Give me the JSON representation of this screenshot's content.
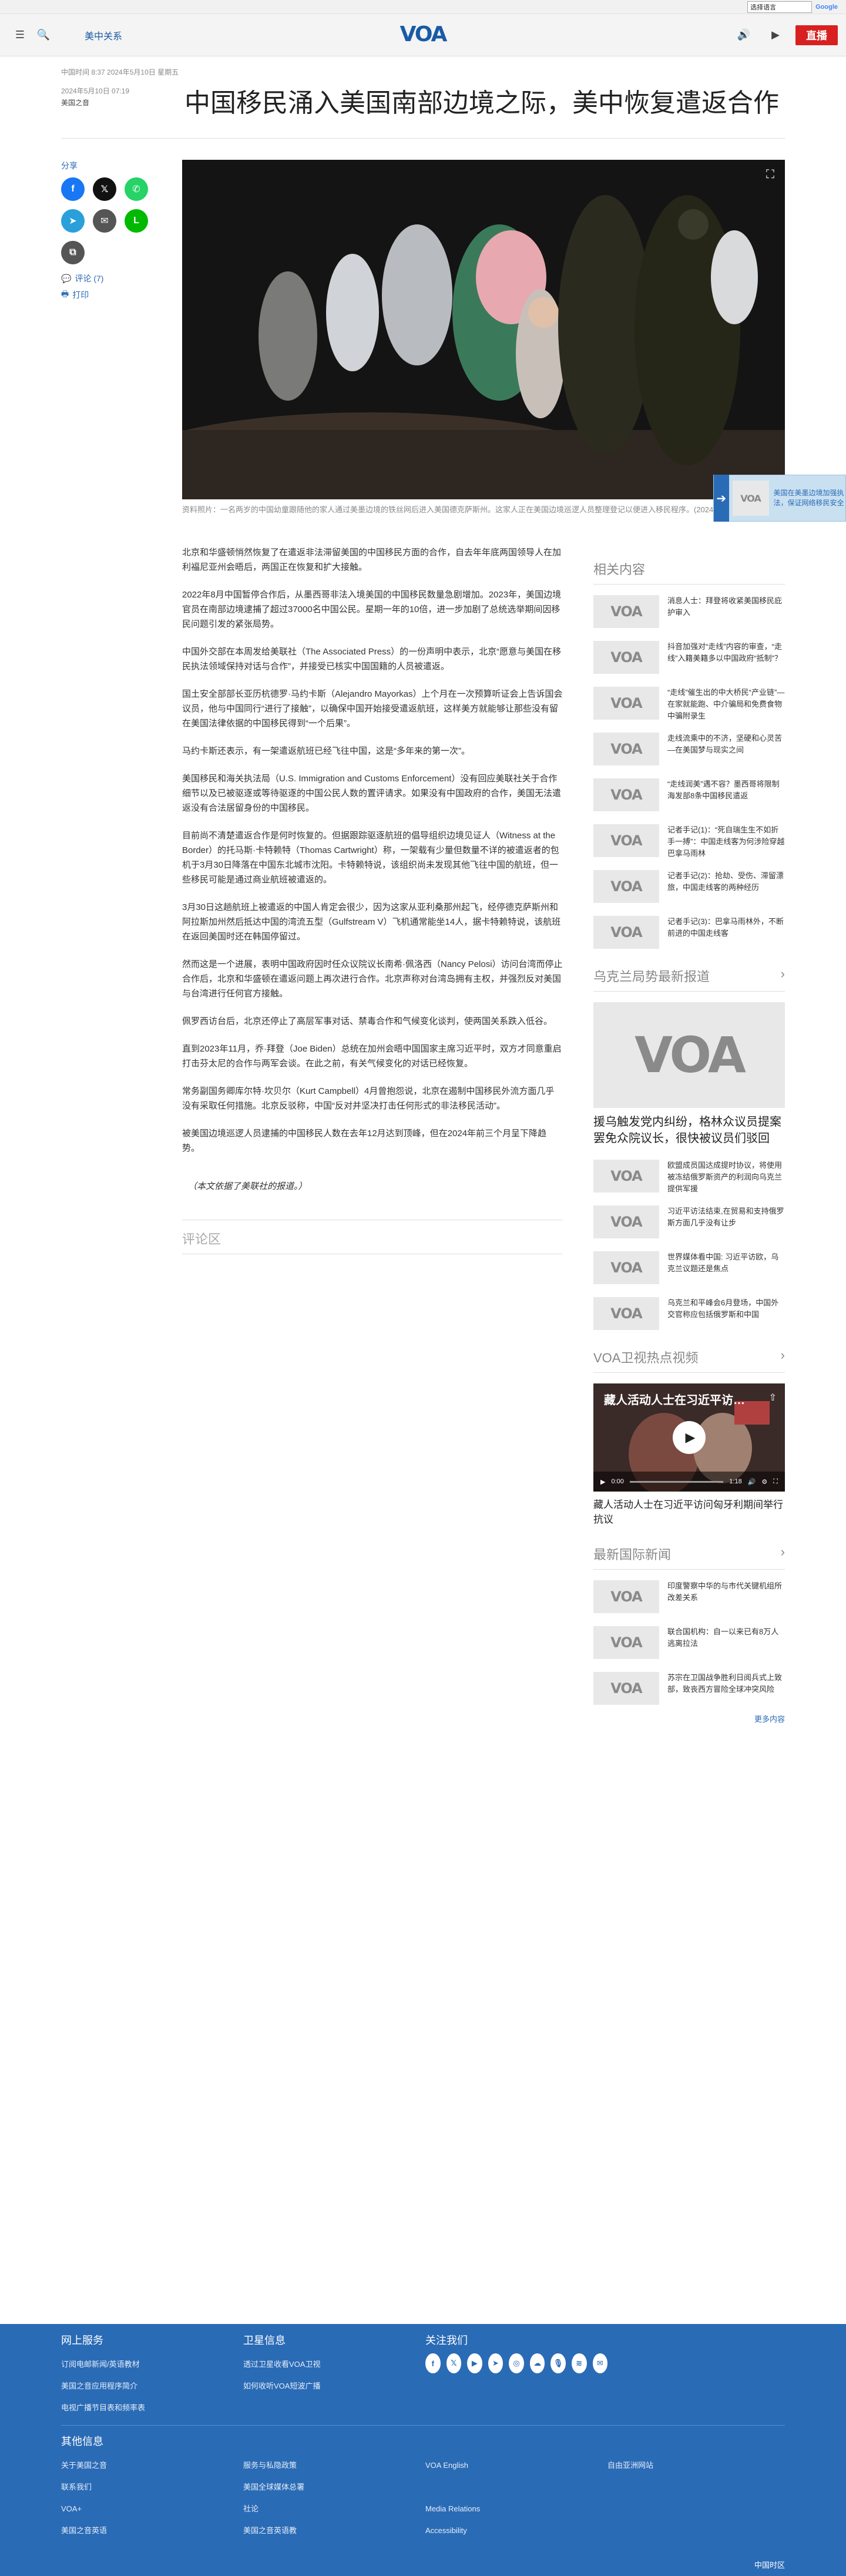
{
  "translate": {
    "select_label": "选择语言",
    "powered_by": "由 Google 提供翻译",
    "brand": "Google"
  },
  "header": {
    "section": "美中关系",
    "logo": "VOA",
    "live": "直播"
  },
  "article": {
    "published_line": "中国时间 8:37 2024年5月10日 星期五",
    "date": "2024年5月10日 07:19",
    "source": "美国之音",
    "title": "中国移民涌入美国南部边境之际，美中恢复遣返合作",
    "caption": "资料照片：一名两岁的中国幼童跟随他的家人通过美墨边境的铁丝网后进入美国德克萨斯州。这家人正在美国边境巡逻人员整理登记以便进入移民程序。(2024年4月23日)",
    "paragraphs": [
      "北京和华盛顿悄然恢复了在遣返非法滞留美国的中国移民方面的合作，自去年年底两国领导人在加利福尼亚州会晤后，两国正在恢复和扩大接触。",
      "2022年8月中国暂停合作后，从墨西哥非法入境美国的中国移民数量急剧增加。2023年，美国边境官员在南部边境逮捕了超过37000名中国公民。星期一年的10倍，进一步加剧了总统选举期间因移民问题引发的紧张局势。",
      "中国外交部在本周发给美联社（The Associated Press）的一份声明中表示，北京“愿意与美国在移民执法领域保持对话与合作”，并接受已核实中国国籍的人员被遣返。",
      "国土安全部部长亚历杭德罗·马约卡斯（Alejandro Mayorkas）上个月在一次预算听证会上告诉国会议员，他与中国同行“进行了接触”，以确保中国开始接受遣返航班，这样美方就能够让那些没有留在美国法律依据的中国移民得到“一个后果”。",
      "马约卡斯还表示，有一架遣返航班已经飞往中国，这是“多年来的第一次”。",
      "美国移民和海关执法局（U.S. Immigration and Customs Enforcement）没有回应美联社关于合作细节以及已被驱逐或等待驱逐的中国公民人数的置评请求。如果没有中国政府的合作，美国无法遣返没有合法居留身份的中国移民。",
      "目前尚不清楚遣返合作是何时恢复的。但据跟踪驱逐航班的倡导组织边境见证人（Witness at the Border）的托马斯·卡特赖特（Thomas Cartwright）称，一架载有少量但数量不详的被遣返者的包机于3月30日降落在中国东北城市沈阳。卡特赖特说，该组织尚未发现其他飞往中国的航班，但一些移民可能是通过商业航班被遣返的。",
      "3月30日这趟航班上被遣返的中国人肯定会很少，因为这家从亚利桑那州起飞，经停德克萨斯州和阿拉斯加州然后抵达中国的湾流五型（Gulfstream V）飞机通常能坐14人，据卡特赖特说，该航班在返回美国时还在韩国停留过。",
      "然而这是一个进展，表明中国政府因时任众议院议长南希·佩洛西（Nancy Pelosi）访问台湾而停止合作后，北京和华盛顿在遣返问题上再次进行合作。北京声称对台湾岛拥有主权，并强烈反对美国与台湾进行任何官方接触。",
      "佩罗西访台后，北京还停止了高层军事对话、禁毒合作和气候变化谈判，使两国关系跌入低谷。",
      "直到2023年11月，乔·拜登（Joe Biden）总统在加州会晤中国国家主席习近平时，双方才同意重启打击芬太尼的合作与两军会谈。在此之前，有关气候变化的对话已经恢复。",
      "常务副国务卿库尔特·坎贝尔（Kurt Campbell）4月曾抱怨说，北京在遏制中国移民外流方面几乎没有采取任何措施。北京反驳称，中国“反对并坚决打击任何形式的非法移民活动”。",
      "被美国边境巡逻人员逮捕的中国移民人数在去年12月达到顶峰，但在2024年前三个月呈下降趋势。"
    ],
    "note": "（本文依据了美联社的报道。）"
  },
  "share": {
    "label": "分享",
    "comments": "评论 (7)",
    "print": "打印"
  },
  "comments_section": {
    "title": "评论区"
  },
  "promo": {
    "text": "美国在美墨边境加强执法，保证网络移民安全"
  },
  "related": {
    "title": "相关内容",
    "items": [
      "消息人士：拜登将收紧美国移民庇护审入",
      "抖音加强对“走线”内容的审查，“走线”入籍美籍多以中国政府“抵制”？",
      "“走线”催生出的中大桥民“产业链”—在家就能跑、中介骗局和免费食物中骗附录生",
      "走线流乘中的不济，坚硬和心灵苦—在美国梦与现实之间",
      "“走线润美”遇不容？墨西哥将限制海发部8条中国移民遣返",
      "记者手记(1)：“死自瑞生生不如折手一搏”：中国走线客为何涉险穿越巴拿马雨林",
      "记者手记(2)：抢劫、受伤、滞留漂旅，中国走线客的两种经历",
      "记者手记(3)：巴拿马雨林外，不断前进的中国走线客"
    ]
  },
  "ukraine": {
    "title": "乌克兰局势最新报道",
    "big": "援乌触发党内纠纷，格林众议员提案罢免众院议长，很快被议员们驳回",
    "items": [
      "欧盟成员国达成提时协议，将使用被冻结俄罗斯资产的利润向乌克兰提供军援",
      "习近平访法结束,在贸易和支持俄罗斯方面几乎没有让步",
      "世界媒体看中国: 习近平访欧，乌克兰议题还是焦点",
      "乌克兰和平峰会6月登场，中国外交官称应包括俄罗斯和中国"
    ]
  },
  "video": {
    "title": "VOA卫视热点视频",
    "overlay": "藏人活动人士在习近平访…",
    "time": "0:00",
    "dur": "1:18",
    "caption": "藏人活动人士在习近平访问匈牙利期间举行抗议"
  },
  "world": {
    "title": "最新国际新闻",
    "items": [
      "印度警察中华的与市代关键机组所改差关系",
      "联合国机构：自一以来已有8万人逃离拉法",
      "苏宗在卫国战争胜利日阅兵式上致部，致丧西方冒险全球冲突风险"
    ],
    "more": "更多内容"
  },
  "footer": {
    "col1": {
      "title": "网上服务",
      "links": [
        "订阅电邮新闻/英语教材",
        "美国之音应用程序简介",
        "电视广播节目表和频率表"
      ]
    },
    "col2": {
      "title": "卫星信息",
      "links": [
        "透过卫星收看VOA卫视",
        "如何收听VOA短波广播"
      ]
    },
    "col3": {
      "title": "关注我们"
    },
    "other_title": "其他信息",
    "other": [
      "关于美国之音",
      "服务与私隐政策",
      "VOA English",
      "自由亚洲网站",
      "联系我们",
      "美国全球媒体总署",
      "",
      "",
      "VOA+",
      "社论",
      "Media Relations",
      "",
      "美国之音英语",
      "美国之音英语教",
      "Accessibility",
      ""
    ],
    "copyright": "中国时区"
  },
  "colors": {
    "brand": "#2a6bb6",
    "live": "#d82020"
  }
}
